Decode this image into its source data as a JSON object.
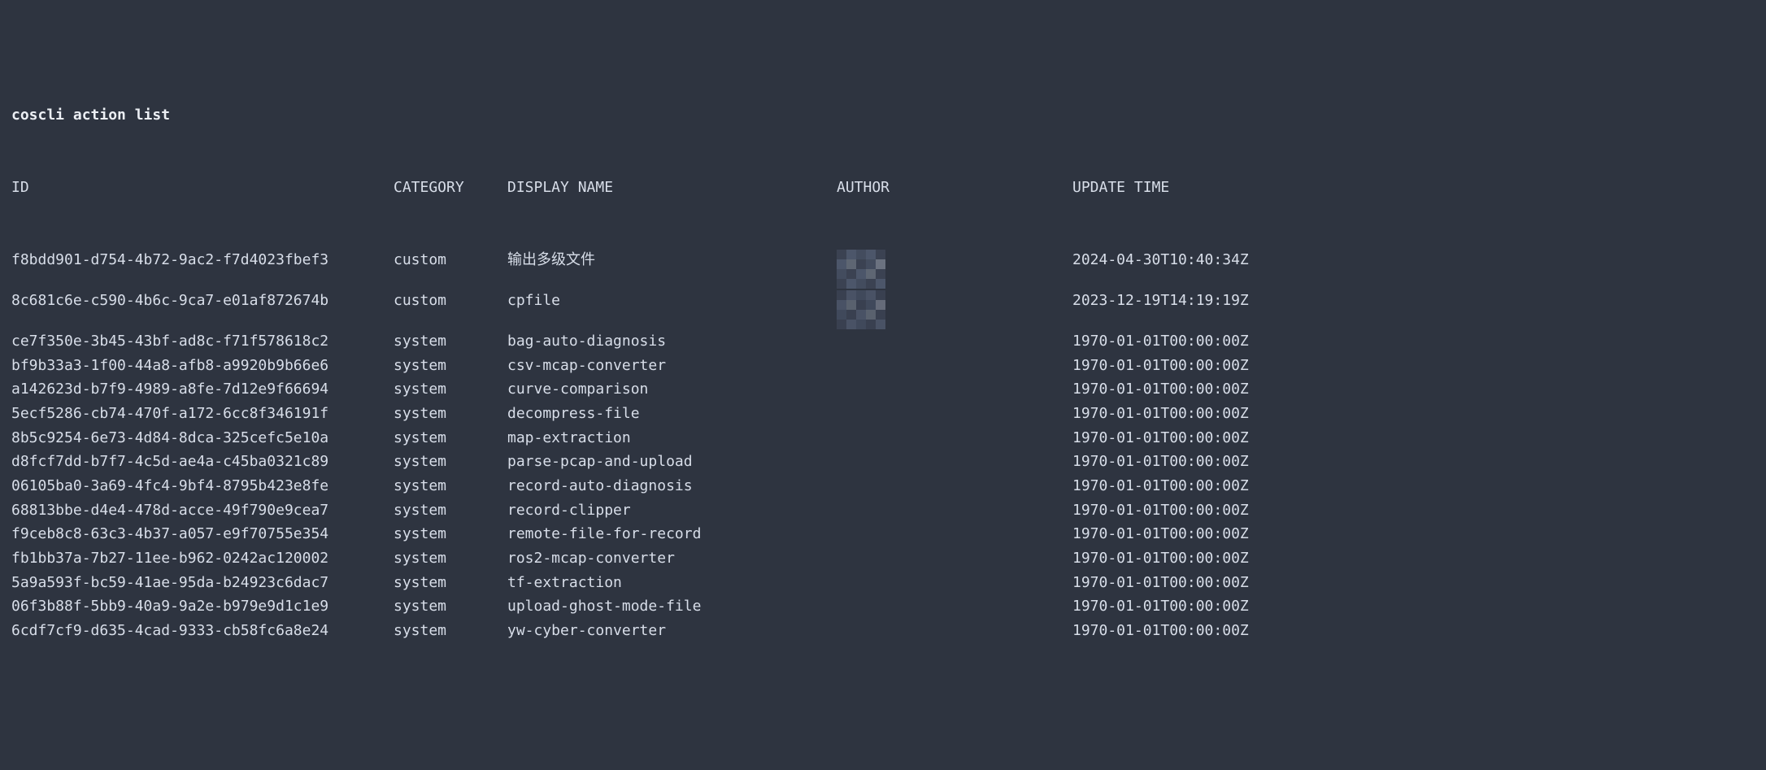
{
  "command": "coscli action list",
  "columns": {
    "id": "ID",
    "category": "CATEGORY",
    "display_name": "DISPLAY NAME",
    "author": "AUTHOR",
    "update_time": "UPDATE TIME"
  },
  "rows": [
    {
      "id": "f8bdd901-d754-4b72-9ac2-f7d4023fbef3",
      "category": "custom",
      "display_name": "输出多级文件",
      "author": "",
      "update_time": "2024-04-30T10:40:34Z"
    },
    {
      "id": "8c681c6e-c590-4b6c-9ca7-e01af872674b",
      "category": "custom",
      "display_name": "cpfile",
      "author": "",
      "update_time": "2023-12-19T14:19:19Z"
    },
    {
      "id": "ce7f350e-3b45-43bf-ad8c-f71f578618c2",
      "category": "system",
      "display_name": "bag-auto-diagnosis",
      "author": "",
      "update_time": "1970-01-01T00:00:00Z"
    },
    {
      "id": "bf9b33a3-1f00-44a8-afb8-a9920b9b66e6",
      "category": "system",
      "display_name": "csv-mcap-converter",
      "author": "",
      "update_time": "1970-01-01T00:00:00Z"
    },
    {
      "id": "a142623d-b7f9-4989-a8fe-7d12e9f66694",
      "category": "system",
      "display_name": "curve-comparison",
      "author": "",
      "update_time": "1970-01-01T00:00:00Z"
    },
    {
      "id": "5ecf5286-cb74-470f-a172-6cc8f346191f",
      "category": "system",
      "display_name": "decompress-file",
      "author": "",
      "update_time": "1970-01-01T00:00:00Z"
    },
    {
      "id": "8b5c9254-6e73-4d84-8dca-325cefc5e10a",
      "category": "system",
      "display_name": "map-extraction",
      "author": "",
      "update_time": "1970-01-01T00:00:00Z"
    },
    {
      "id": "d8fcf7dd-b7f7-4c5d-ae4a-c45ba0321c89",
      "category": "system",
      "display_name": "parse-pcap-and-upload",
      "author": "",
      "update_time": "1970-01-01T00:00:00Z"
    },
    {
      "id": "06105ba0-3a69-4fc4-9bf4-8795b423e8fe",
      "category": "system",
      "display_name": "record-auto-diagnosis",
      "author": "",
      "update_time": "1970-01-01T00:00:00Z"
    },
    {
      "id": "68813bbe-d4e4-478d-acce-49f790e9cea7",
      "category": "system",
      "display_name": "record-clipper",
      "author": "",
      "update_time": "1970-01-01T00:00:00Z"
    },
    {
      "id": "f9ceb8c8-63c3-4b37-a057-e9f70755e354",
      "category": "system",
      "display_name": "remote-file-for-record",
      "author": "",
      "update_time": "1970-01-01T00:00:00Z"
    },
    {
      "id": "fb1bb37a-7b27-11ee-b962-0242ac120002",
      "category": "system",
      "display_name": "ros2-mcap-converter",
      "author": "",
      "update_time": "1970-01-01T00:00:00Z"
    },
    {
      "id": "5a9a593f-bc59-41ae-95da-b24923c6dac7",
      "category": "system",
      "display_name": "tf-extraction",
      "author": "",
      "update_time": "1970-01-01T00:00:00Z"
    },
    {
      "id": "06f3b88f-5bb9-40a9-9a2e-b979e9d1c1e9",
      "category": "system",
      "display_name": "upload-ghost-mode-file",
      "author": "",
      "update_time": "1970-01-01T00:00:00Z"
    },
    {
      "id": "6cdf7cf9-d635-4cad-9333-cb58fc6a8e24",
      "category": "system",
      "display_name": "yw-cyber-converter",
      "author": "",
      "update_time": "1970-01-01T00:00:00Z"
    }
  ]
}
